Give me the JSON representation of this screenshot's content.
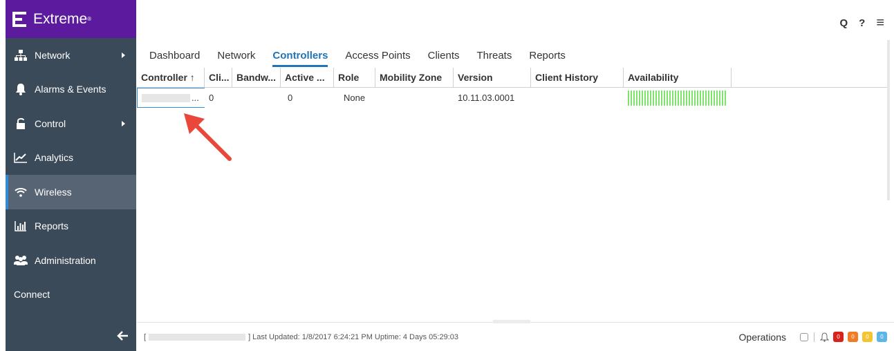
{
  "brand": {
    "name": "Extreme",
    "mark": "®"
  },
  "sidebar": {
    "items": [
      {
        "label": "Network",
        "icon": "network-icon",
        "has_submenu": true
      },
      {
        "label": "Alarms & Events",
        "icon": "bell-icon"
      },
      {
        "label": "Control",
        "icon": "lock-icon",
        "has_submenu": true
      },
      {
        "label": "Analytics",
        "icon": "analytics-icon"
      },
      {
        "label": "Wireless",
        "icon": "wifi-icon",
        "active": true
      },
      {
        "label": "Reports",
        "icon": "reports-icon"
      },
      {
        "label": "Administration",
        "icon": "users-icon"
      },
      {
        "label": "Connect",
        "icon": ""
      }
    ],
    "collapse_icon": "arrow-left-icon"
  },
  "top_icons": {
    "search": "Q",
    "help": "?",
    "menu": "≡"
  },
  "tabs": [
    "Dashboard",
    "Network",
    "Controllers",
    "Access Points",
    "Clients",
    "Threats",
    "Reports"
  ],
  "active_tab": "Controllers",
  "grid": {
    "columns": [
      "Controller ↑",
      "Cli...",
      "Bandw...",
      "Active ...",
      "Role",
      "Mobility Zone",
      "Version",
      "Client History",
      "Availability"
    ],
    "rows": [
      {
        "controller": "...",
        "clients": "0",
        "bandwidth": "",
        "active": "0",
        "role": "None",
        "mobility_zone": "",
        "version": "10.11.03.0001",
        "client_history": ""
      }
    ],
    "availability_color": "#7ee36a"
  },
  "footer": {
    "bracket_open": "[",
    "status": "] Last Updated: 1/8/2017 6:24:21 PM  Uptime: 4 Days 05:29:03",
    "operations": "Operations",
    "badges": [
      {
        "value": "0",
        "color": "#d9221c"
      },
      {
        "value": "0",
        "color": "#f07d26"
      },
      {
        "value": "0",
        "color": "#f4c431"
      },
      {
        "value": "0",
        "color": "#5db5e8"
      }
    ]
  },
  "colors": {
    "sidebar_bg": "#3b4a59",
    "logo_bg": "#5c1b9f",
    "accent": "#1f73b7",
    "arrow": "#e8473a"
  }
}
